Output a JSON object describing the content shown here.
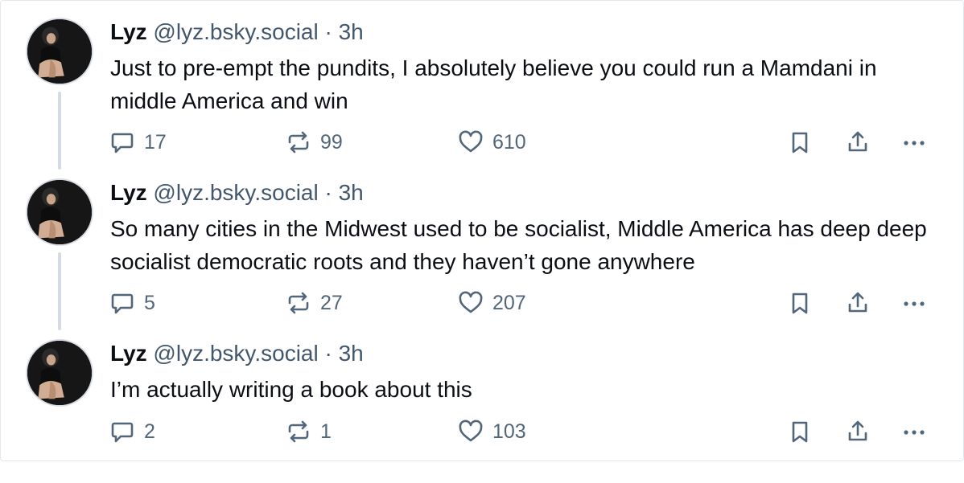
{
  "posts": [
    {
      "author": "Lyz",
      "handle": "@lyz.bsky.social",
      "separator": "·",
      "time": "3h",
      "text": "Just to pre-empt the pundits, I absolutely believe you could run a Mamdani in middle America and win",
      "replies": "17",
      "reposts": "99",
      "likes": "610"
    },
    {
      "author": "Lyz",
      "handle": "@lyz.bsky.social",
      "separator": "·",
      "time": "3h",
      "text": "So many cities in the Midwest used to be socialist, Middle America has deep deep socialist democratic roots and they haven’t gone anywhere",
      "replies": "5",
      "reposts": "27",
      "likes": "207"
    },
    {
      "author": "Lyz",
      "handle": "@lyz.bsky.social",
      "separator": "·",
      "time": "3h",
      "text": "I’m actually writing a book about this",
      "replies": "2",
      "reposts": "1",
      "likes": "103"
    }
  ],
  "icons": {
    "reply": "speech-bubble-icon",
    "repost": "repost-arrows-icon",
    "like": "heart-icon",
    "bookmark": "bookmark-icon",
    "share": "share-upload-icon",
    "more": "ellipsis-icon"
  },
  "colors": {
    "text": "#0b0f14",
    "secondary": "#42576c",
    "icon": "#52667a",
    "thread_line": "#d4dbe2"
  }
}
